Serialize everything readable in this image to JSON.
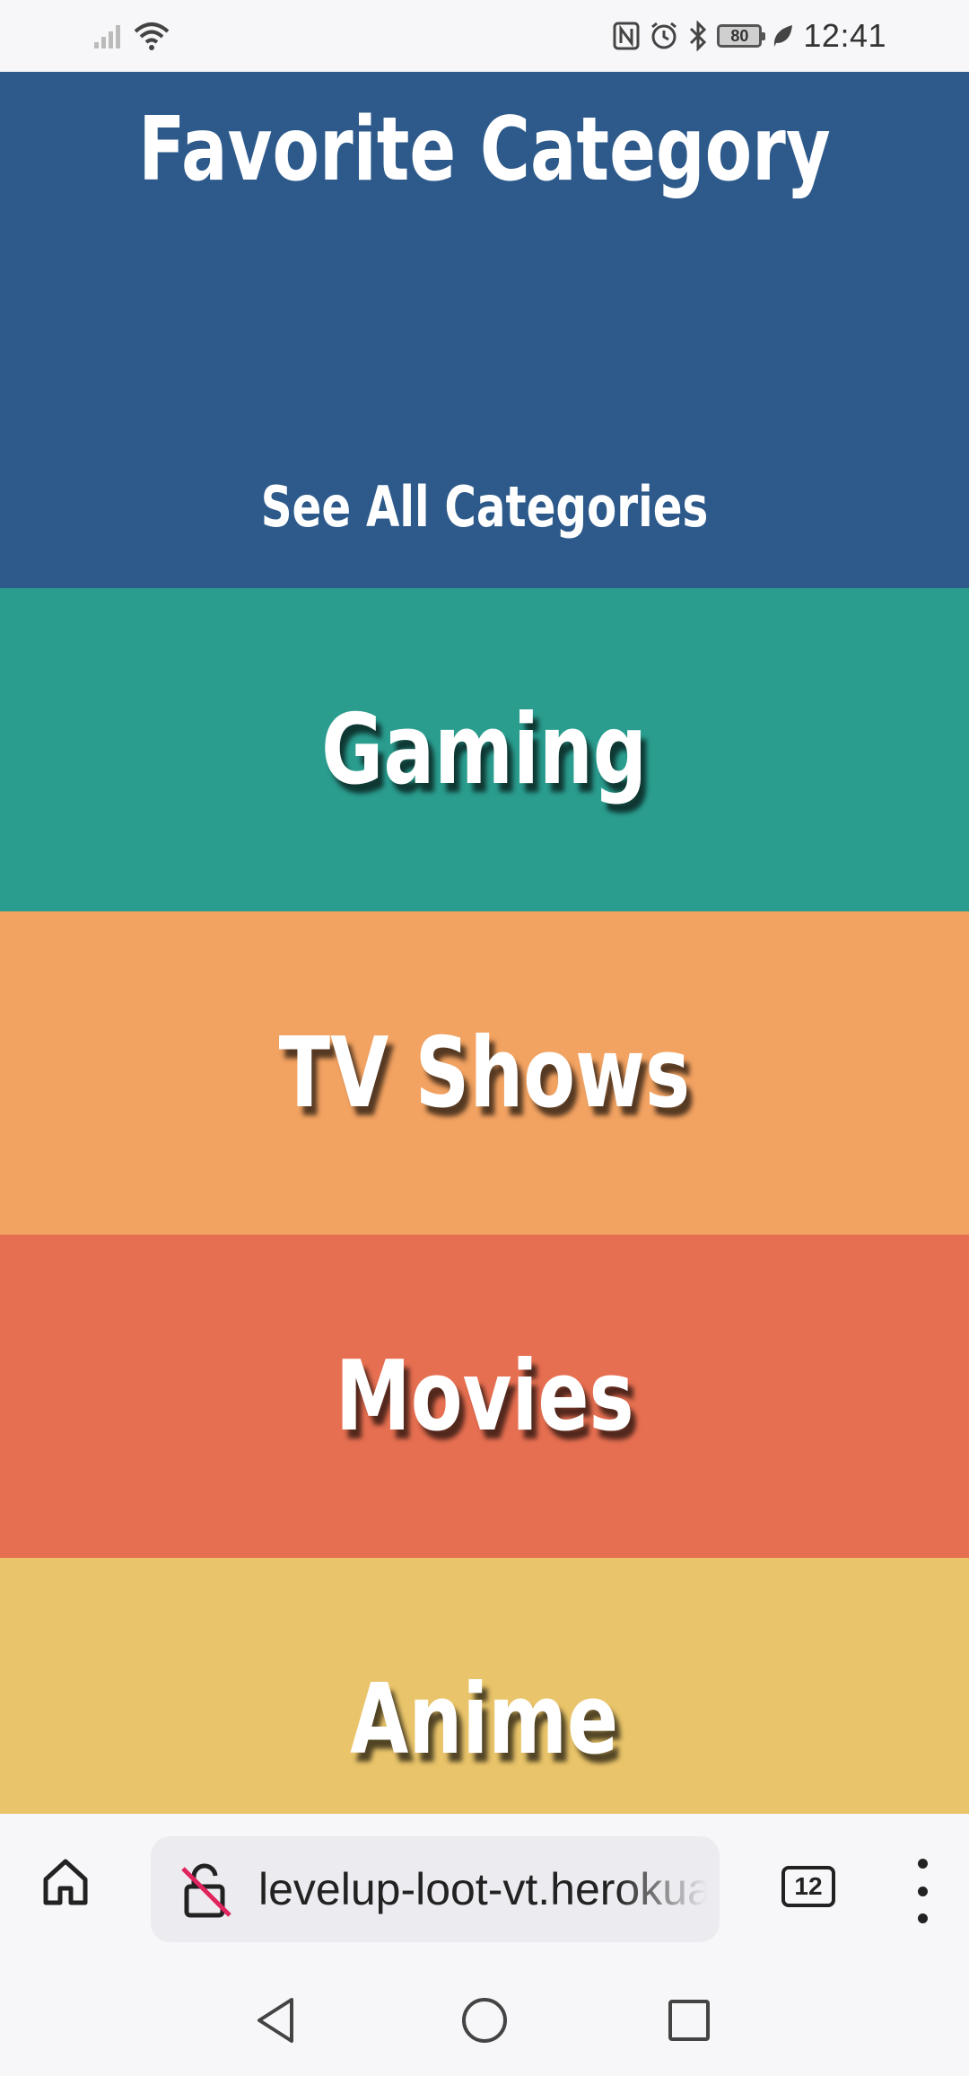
{
  "status_bar": {
    "time": "12:41",
    "battery": "80",
    "icons": [
      "signal-icon",
      "wifi-icon",
      "nfc-icon",
      "alarm-icon",
      "bluetooth-icon",
      "battery-icon",
      "leaf-icon"
    ]
  },
  "hero": {
    "title": "Favorite Category",
    "link": "See All Categories",
    "color": "#2d5a8b"
  },
  "categories": [
    {
      "label": "Gaming",
      "color": "#2a9d8f"
    },
    {
      "label": "TV Shows",
      "color": "#f2a261"
    },
    {
      "label": "Movies",
      "color": "#e76f51"
    },
    {
      "label": "Anime",
      "color": "#e9c46a"
    }
  ],
  "browser": {
    "url": "levelup-loot-vt.herokuapp.com",
    "tab_count": "12",
    "icons": [
      "home-icon",
      "insecure-lock-icon",
      "tabs-icon",
      "more-menu-icon"
    ]
  },
  "nav": {
    "icons": [
      "back-icon",
      "home-circle-icon",
      "recents-icon"
    ]
  }
}
